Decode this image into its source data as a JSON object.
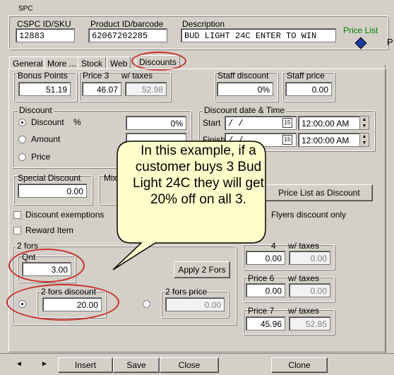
{
  "title_fragment": "SPC",
  "header": {
    "cspc_label": "CSPC ID/SKU",
    "cspc_value": "12883",
    "product_label": "Product ID/barcode",
    "product_value": "62067202285",
    "desc_label": "Description",
    "desc_value": "BUD LIGHT 24C ENTER TO WIN",
    "price_list_label": "Price List",
    "side_letter": "P"
  },
  "tabs": [
    "General",
    "More ...",
    "Stock",
    "Web",
    "Discounts"
  ],
  "bonus": {
    "label": "Bonus Points",
    "value": "51.19"
  },
  "price3": {
    "label": "Price 3",
    "value": "46.07",
    "taxes_label": "w/  taxes",
    "taxes_value": "52.98"
  },
  "staff_discount": {
    "label": "Staff discount",
    "value": "0%"
  },
  "staff_price": {
    "label": "Staff price",
    "value": "0.00"
  },
  "discount": {
    "group_label": "Discount",
    "options": [
      "Discount",
      "Amount",
      "Price"
    ],
    "pct_symbol": "%",
    "discount_value": "0%"
  },
  "discount_dates": {
    "label": "Discount date & Time",
    "start_label": "Start",
    "finish_label": "Finish",
    "start_date": " /  /",
    "finish_date": " /  /",
    "start_time": "12:00:00 AM",
    "finish_time": "12:00:00 AM",
    "cal_icon": "15"
  },
  "special_discount": {
    "label": "Special Discount",
    "value": "0.00"
  },
  "mixmatch_label": "Mixma",
  "price_list_discount_button": "Price List as Discount",
  "checks": {
    "discount_exemptions": "Discount exemptions",
    "reward_item": "Reward Item",
    "flyers_only": "Flyers discount only"
  },
  "two_fors": {
    "group_label": "2 fors",
    "qnt_label": "Qnt",
    "qnt_value": "3.00",
    "apply_button": "Apply 2 Fors",
    "discount_label": "2 fors discount",
    "discount_value": "20.00",
    "price_label": "2 fors price",
    "price_value": "0.00"
  },
  "prices": [
    {
      "label": "4",
      "value": "0.00",
      "taxes_label": "w/  taxes",
      "taxes_value": "0.00"
    },
    {
      "label": "Price 6",
      "value": "0.00",
      "taxes_label": "w/  taxes",
      "taxes_value": "0.00"
    },
    {
      "label": "Price 7",
      "value": "45.96",
      "taxes_label": "w/  taxes",
      "taxes_value": "52.85"
    }
  ],
  "callout": {
    "text": "In this example, if a customer buys 3 Bud Light 24C they will get 20% off on all 3."
  },
  "footer": {
    "prev": "◄",
    "next": "►",
    "insert": "Insert",
    "save": "Save",
    "close": "Close",
    "clone": "Clone"
  },
  "colors": {
    "accent_green": "#008000",
    "annotation_red": "#c8302a",
    "callout_fill": "#ffffcc"
  }
}
